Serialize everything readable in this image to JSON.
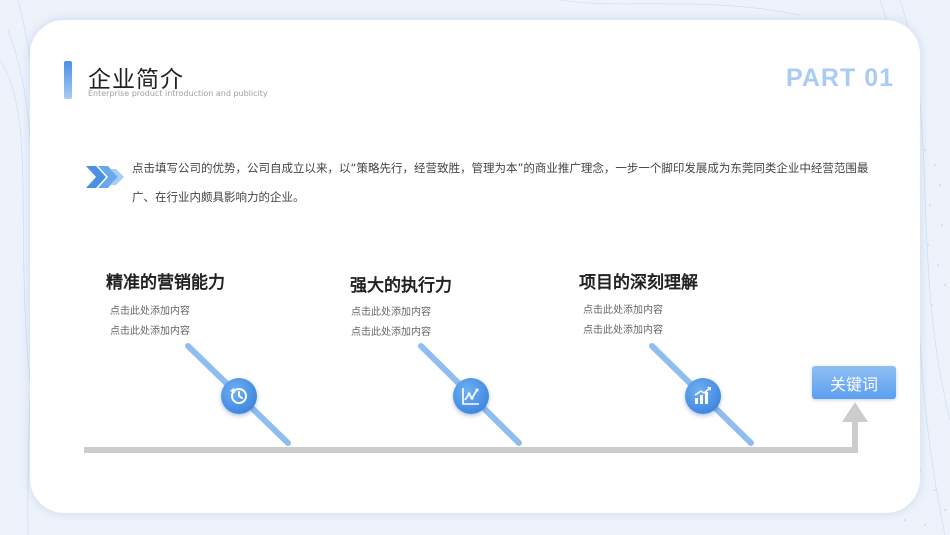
{
  "header": {
    "title": "企业简介",
    "subtitle": "Enterprise product introduction and publicity",
    "part_label": "PART 01"
  },
  "intro": {
    "text": "点击填写公司的优势，公司自成立以来，以“策略先行，经营致胜，管理为本”的商业推广理念，一步一个脚印发展成为东莞同类企业中经营范围最广、在行业内颇具影响力的企业。"
  },
  "items": [
    {
      "title": "精准的营销能力",
      "line1": "点击此处添加内容",
      "line2": "点击此处添加内容",
      "icon": "clock-refresh-icon"
    },
    {
      "title": "强大的执行力",
      "line1": "点击此处添加内容",
      "line2": "点击此处添加内容",
      "icon": "line-chart-icon"
    },
    {
      "title": "项目的深刻理解",
      "line1": "点击此处添加内容",
      "line2": "点击此处添加内容",
      "icon": "growth-bars-icon"
    }
  ],
  "keyword_button": {
    "label": "关键词"
  },
  "colors": {
    "accent": "#4a90e2",
    "part_label": "#a9cbf6",
    "diagonal": "#8fbdf2",
    "baseline": "#cccccc"
  }
}
